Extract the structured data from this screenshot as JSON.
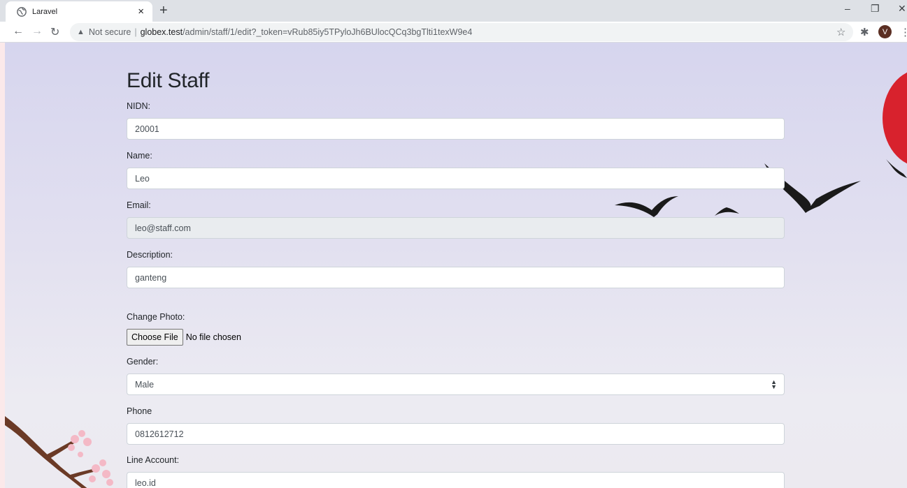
{
  "browser": {
    "tab_title": "Laravel",
    "tab_close": "×",
    "new_tab": "+",
    "url_warning": "Not secure",
    "url_separator": "|",
    "url_host": "globex.test",
    "url_path": "/admin/staff/1/edit?_token=vRub85iy5TPyloJh6BUlocQCq3bgTlti1texW9e4",
    "profile_initial": "V"
  },
  "form": {
    "title": "Edit Staff",
    "nidn_label": "NIDN:",
    "nidn_value": "20001",
    "name_label": "Name:",
    "name_value": "Leo",
    "email_label": "Email:",
    "email_value": "leo@staff.com",
    "description_label": "Description:",
    "description_value": "ganteng",
    "photo_label": "Change Photo:",
    "photo_button": "Choose File",
    "photo_status": "No file chosen",
    "gender_label": "Gender:",
    "gender_value": "Male",
    "phone_label": "Phone",
    "phone_value": "0812612712",
    "line_label": "Line Account:",
    "line_value": "leo.id"
  },
  "colors": {
    "sun": "#d8222d",
    "branch": "#6b3a26",
    "blossom": "#f4b9c6"
  }
}
